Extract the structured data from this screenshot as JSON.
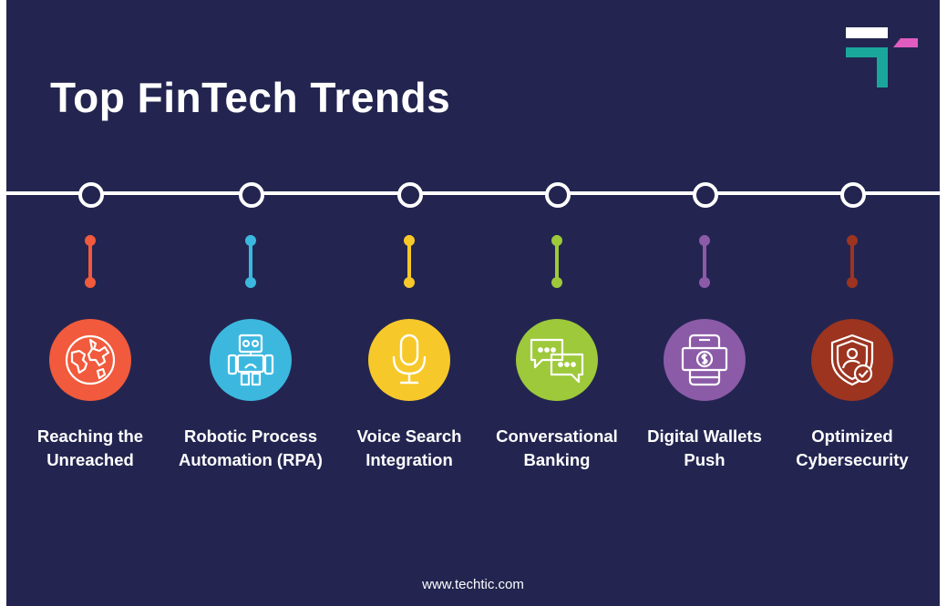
{
  "title": "Top FinTech Trends",
  "website": "www.techtic.com",
  "colors": {
    "background": "#232550",
    "logo_white": "#ffffff",
    "logo_teal": "#1aa79b",
    "logo_pink": "#e05cc0"
  },
  "trends": [
    {
      "line1": "Reaching the",
      "line2": "Unreached",
      "color": "#f15a3c",
      "icon": "globe-icon"
    },
    {
      "line1": "Robotic Process",
      "line2": "Automation (RPA)",
      "color": "#3cb8df",
      "icon": "robot-icon"
    },
    {
      "line1": "Voice Search",
      "line2": "Integration",
      "color": "#f7c82a",
      "icon": "microphone-icon"
    },
    {
      "line1": "Conversational",
      "line2": "Banking",
      "color": "#9dc93b",
      "icon": "chat-bubbles-icon"
    },
    {
      "line1": "Digital Wallets",
      "line2": "Push",
      "color": "#8b5ba8",
      "icon": "mobile-wallet-icon"
    },
    {
      "line1": "Optimized",
      "line2": "Cybersecurity",
      "color": "#9c3420",
      "icon": "security-shield-icon"
    }
  ]
}
